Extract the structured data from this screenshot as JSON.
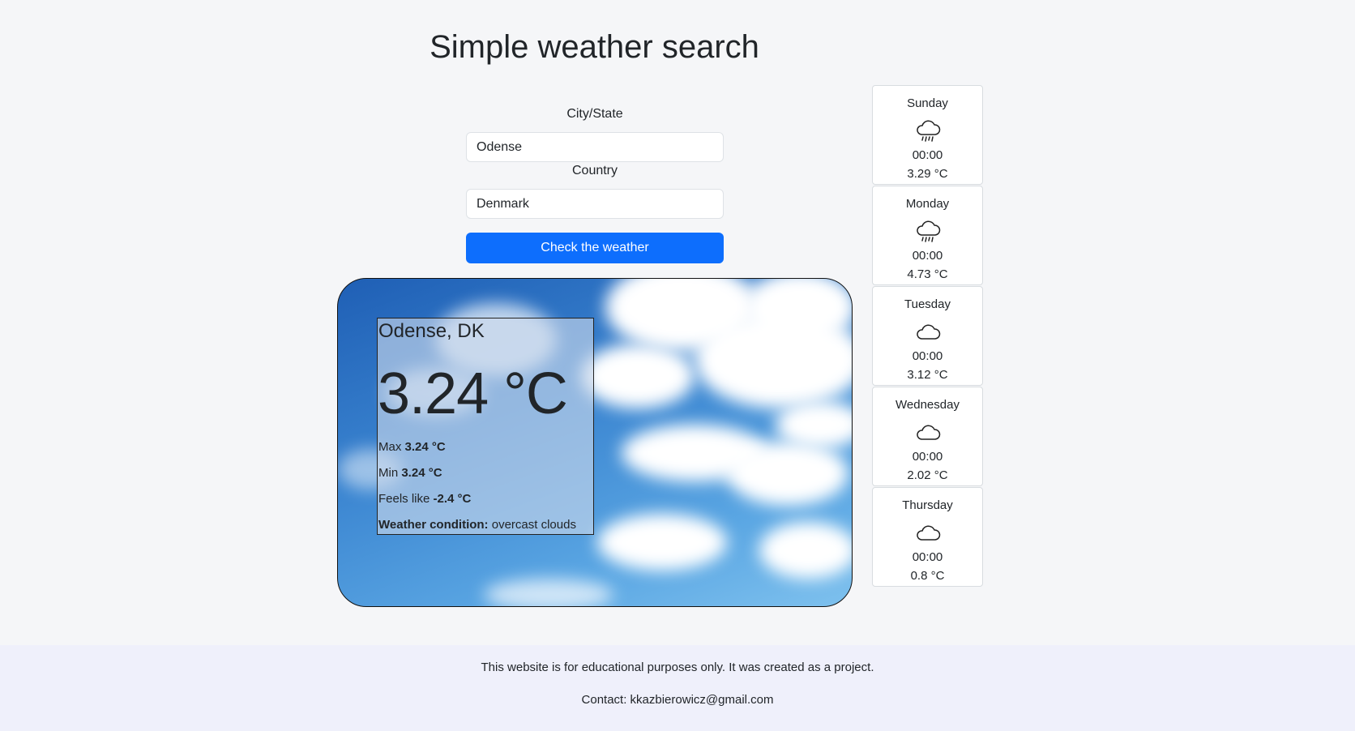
{
  "header": {
    "title": "Simple weather search"
  },
  "form": {
    "city_label": "City/State",
    "city_value": "Odense",
    "country_label": "Country",
    "country_value": "Denmark",
    "submit_label": "Check the weather"
  },
  "current": {
    "location": "Odense, DK",
    "temperature": "3.24 °C",
    "max_label": "Max",
    "max_value": "3.24 °C",
    "min_label": "Min",
    "min_value": "3.24 °C",
    "feels_label": "Feels like",
    "feels_value": "-2.4 °C",
    "condition_label": "Weather condition:",
    "condition_value": "overcast clouds",
    "background": "sky-clouds"
  },
  "forecast": [
    {
      "day": "Sunday",
      "icon": "cloud-rain-icon",
      "time": "00:00",
      "temp": "3.29 °C"
    },
    {
      "day": "Monday",
      "icon": "cloud-rain-icon",
      "time": "00:00",
      "temp": "4.73 °C"
    },
    {
      "day": "Tuesday",
      "icon": "cloud-icon",
      "time": "00:00",
      "temp": "3.12 °C"
    },
    {
      "day": "Wednesday",
      "icon": "cloud-icon",
      "time": "00:00",
      "temp": "2.02 °C"
    },
    {
      "day": "Thursday",
      "icon": "cloud-icon",
      "time": "00:00",
      "temp": "0.8 °C"
    }
  ],
  "footer": {
    "disclaimer": "This website is for educational purposes only. It was created as a project.",
    "contact": "Contact: kkazbierowicz@gmail.com"
  },
  "colors": {
    "accent": "#0d6efd",
    "background": "#f5f6f8",
    "footer": "#eff0fb"
  }
}
